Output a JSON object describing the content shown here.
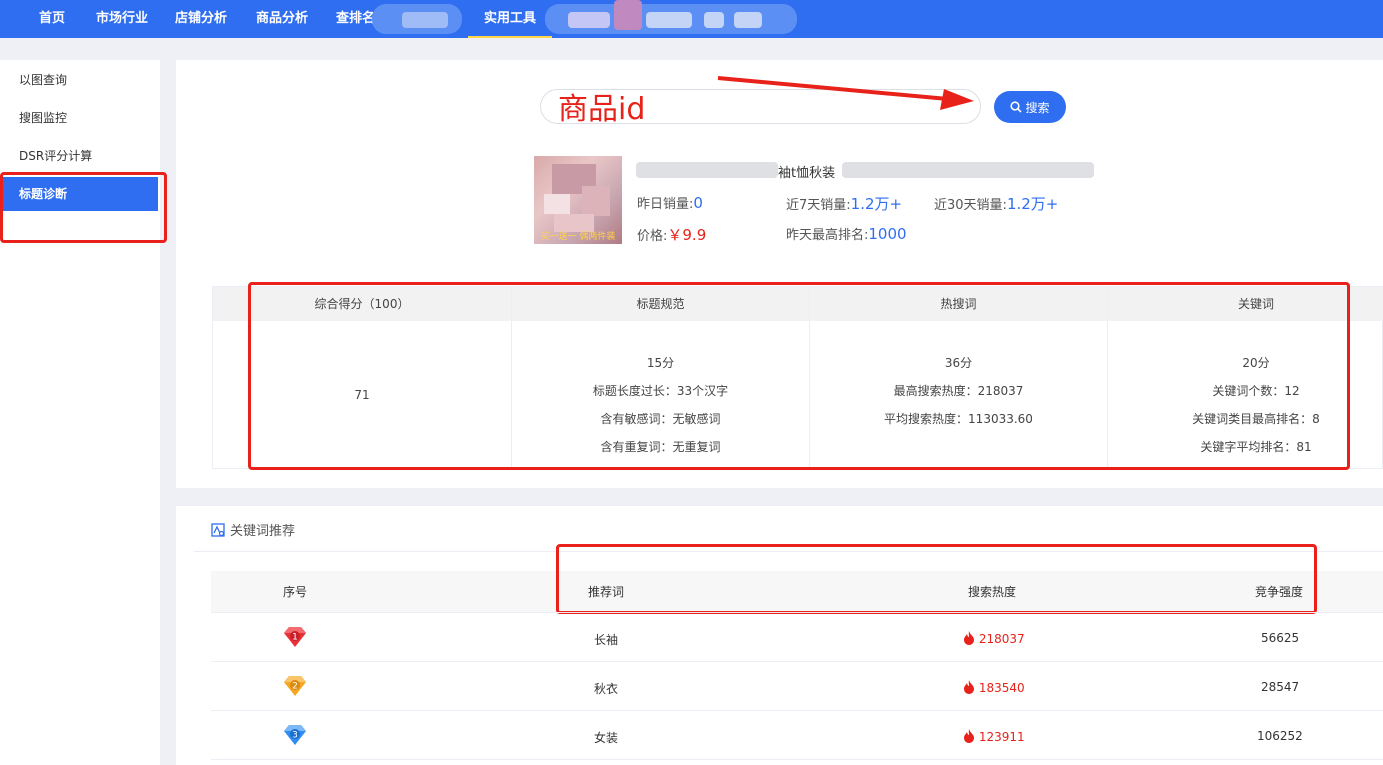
{
  "nav": {
    "items": [
      "首页",
      "市场行业",
      "店铺分析",
      "商品分析",
      "查排名",
      "实用工具"
    ],
    "active_index": 5
  },
  "sidebar": {
    "items": [
      "以图查询",
      "搜图监控",
      "DSR评分计算",
      "标题诊断"
    ],
    "active_index": 3
  },
  "search": {
    "annotation": "商品id",
    "button_label": "搜索"
  },
  "product": {
    "title_visible": "袖t恤秋装",
    "thumb_caption": "买一送一 偶两件装",
    "yesterday_sales_label": "昨日销量:",
    "yesterday_sales": "0",
    "sales_7d_label": "近7天销量:",
    "sales_7d": "1.2万+",
    "sales_30d_label": "近30天销量:",
    "sales_30d": "1.2万+",
    "price_label": "价格:",
    "price": "￥9.9",
    "best_rank_label": "昨天最高排名:",
    "best_rank": "1000"
  },
  "score": {
    "headers": [
      "综合得分（100）",
      "标题规范",
      "热搜词",
      "关键词"
    ],
    "total": "71",
    "title_norm": [
      "15分",
      "标题长度过长：33个汉字",
      "含有敏感词：无敏感词",
      "含有重复词：无重复词"
    ],
    "hot_words": [
      "36分",
      "最高搜索热度：218037",
      "平均搜索热度：113033.60"
    ],
    "keywords": [
      "20分",
      "关键词个数：12",
      "关键词类目最高排名：8",
      "关键字平均排名：81"
    ]
  },
  "keyword_section": {
    "title": "关键词推荐",
    "headers": [
      "序号",
      "推荐词",
      "搜索热度",
      "竞争强度"
    ],
    "rows": [
      {
        "rank": "1",
        "word": "长袖",
        "heat": "218037",
        "competition": "56625",
        "gem_color": "#e8323a"
      },
      {
        "rank": "2",
        "word": "秋衣",
        "heat": "183540",
        "competition": "28547",
        "gem_color": "#f5a623"
      },
      {
        "rank": "3",
        "word": "女装",
        "heat": "123911",
        "competition": "106252",
        "gem_color": "#2f8ef0"
      }
    ]
  },
  "colors": {
    "primary": "#2f6ef0",
    "annotation_red": "#e8221a",
    "hot_red": "#e8221a"
  }
}
